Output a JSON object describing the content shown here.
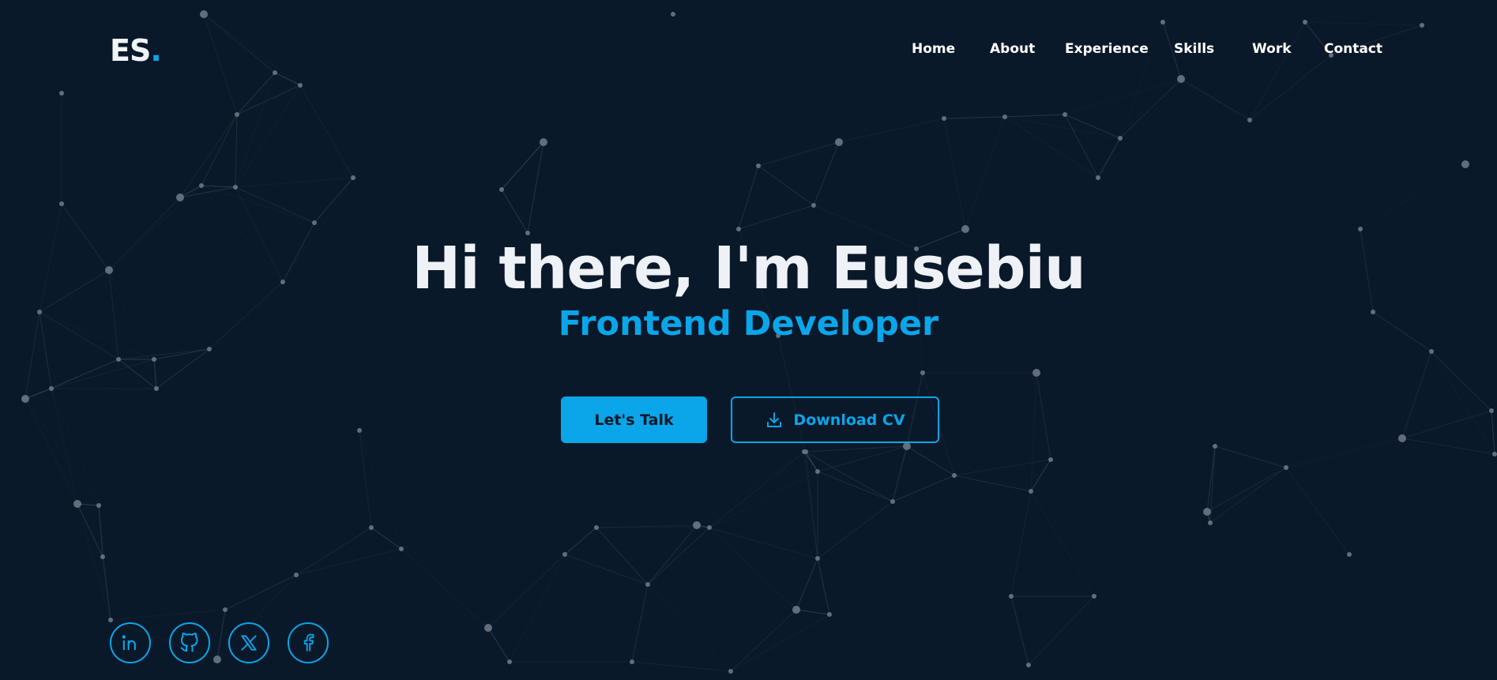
{
  "brand": {
    "logo_text": "ES",
    "logo_dot": ".",
    "accent_color": "#0ba5e9",
    "background_color": "#0a1929"
  },
  "nav": {
    "items": [
      {
        "label": "Home"
      },
      {
        "label": "About"
      },
      {
        "label": "Experience"
      },
      {
        "label": "Skills"
      },
      {
        "label": "Work"
      },
      {
        "label": "Contact"
      }
    ]
  },
  "hero": {
    "title": "Hi there, I'm Eusebiu",
    "subtitle": "Frontend Developer"
  },
  "actions": {
    "talk_label": "Let's Talk",
    "download_label": "Download CV",
    "download_icon": "download-icon"
  },
  "socials": [
    {
      "icon": "linkedin-icon"
    },
    {
      "icon": "github-icon"
    },
    {
      "icon": "x-twitter-icon"
    },
    {
      "icon": "facebook-icon"
    }
  ]
}
